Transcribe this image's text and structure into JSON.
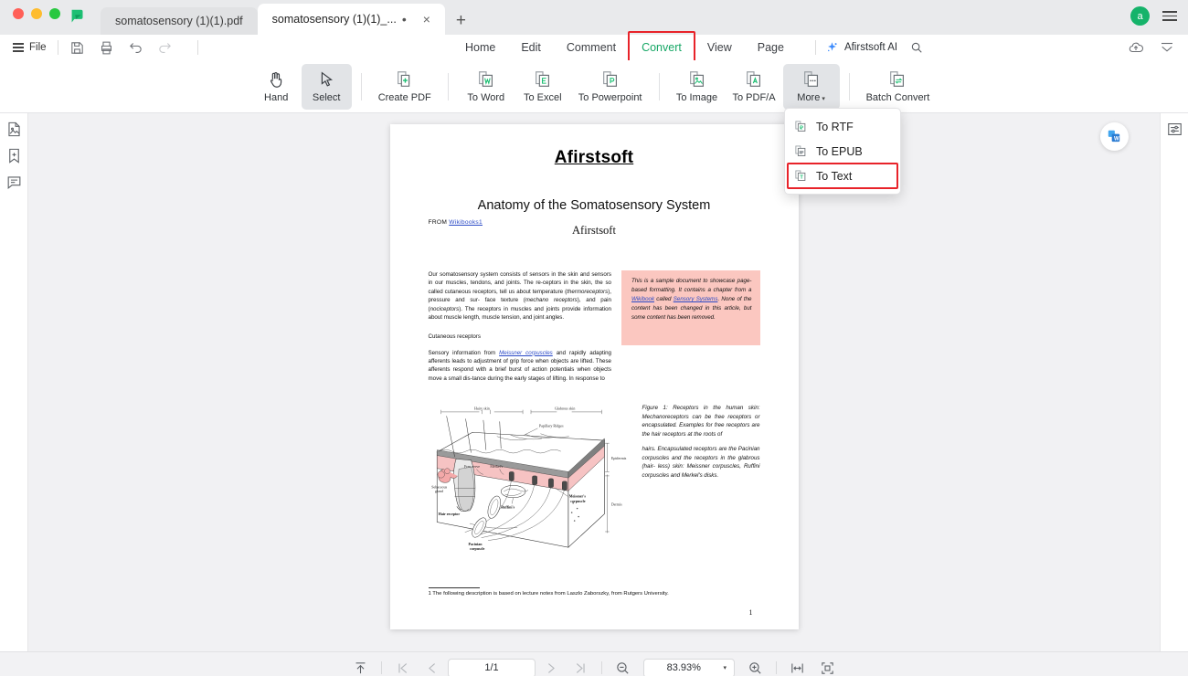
{
  "window": {
    "app_logo": "afirstsoft-flag-logo",
    "tabs": [
      {
        "title": "somatosensory (1)(1).pdf",
        "active": false
      },
      {
        "title": "somatosensory (1)(1)_...",
        "active": true,
        "modified_dot": "•",
        "close": "×"
      }
    ],
    "new_tab_label": "+",
    "avatar_initial": "a",
    "menu_icon": "hamburger-menu-icon"
  },
  "menubar": {
    "file_label": "File",
    "quick_icons": [
      "save-icon",
      "print-icon",
      "undo-icon",
      "redo-icon"
    ],
    "tabs": [
      {
        "label": "Home",
        "active": false
      },
      {
        "label": "Edit",
        "active": false
      },
      {
        "label": "Comment",
        "active": false
      },
      {
        "label": "Convert",
        "active": true,
        "highlighted": true
      },
      {
        "label": "View",
        "active": false
      },
      {
        "label": "Page",
        "active": false
      }
    ],
    "ai_label": "Afirstsoft AI",
    "ai_icon": "sparkle-icon",
    "search_icon": "search-icon",
    "right_icons": [
      "cloud-upload-icon",
      "collapse-ribbon-icon"
    ],
    "highlight_color": "#e8232a",
    "active_color": "#16a765"
  },
  "ribbon": {
    "items": [
      {
        "label": "Hand",
        "icon": "hand-icon",
        "active": false
      },
      {
        "label": "Select",
        "icon": "cursor-select-icon",
        "active": true
      },
      {
        "label": "Create PDF",
        "icon": "create-pdf-icon",
        "active": false
      },
      {
        "label": "To Word",
        "icon": "to-word-icon",
        "active": false
      },
      {
        "label": "To Excel",
        "icon": "to-excel-icon",
        "active": false
      },
      {
        "label": "To Powerpoint",
        "icon": "to-powerpoint-icon",
        "active": false
      },
      {
        "label": "To Image",
        "icon": "to-image-icon",
        "active": false
      },
      {
        "label": "To PDF/A",
        "icon": "to-pdfa-icon",
        "active": false
      },
      {
        "label": "More",
        "icon": "more-icon",
        "active": true,
        "caret": "▾"
      },
      {
        "label": "Batch Convert",
        "icon": "batch-convert-icon",
        "active": false
      }
    ]
  },
  "dropdown": {
    "open": true,
    "items": [
      {
        "label": "To RTF",
        "icon": "to-rtf-icon",
        "highlighted": false
      },
      {
        "label": "To EPUB",
        "icon": "to-epub-icon",
        "highlighted": false
      },
      {
        "label": "To Text",
        "icon": "to-text-icon",
        "highlighted": true
      }
    ]
  },
  "left_rail": {
    "items": [
      "thumbnails-icon",
      "bookmark-add-icon",
      "comment-icon"
    ]
  },
  "right_rail": {
    "items": [
      "properties-panel-icon"
    ]
  },
  "canvas": {
    "floating_badge": "convert-to-word-badge"
  },
  "document": {
    "brand_heading": "Afirstsoft",
    "title": "Anatomy of the Somatosensory System",
    "subtitle": "Afirstsoft",
    "from_label": "FROM",
    "from_link": "Wikibooks",
    "from_footnote_marker": "1",
    "paragraph_1": "Our somatosensory system consists of sensors in the skin and sensors in our muscles, tendons, and joints. The receptors in the skin, the so called cutaneous receptors, tell us about temperature (thermoreceptors), pressure and sur- face texture (mechano receptors), and pain (nociceptors). The receptors in muscles and joints provide information about muscle length, muscle tension, and joint angles.",
    "subheading": "Cutaneous receptors",
    "paragraph_2": "Sensory information from Meissner corpuscles and rapidly adapting afferents leads to adjustment of grip force when objects are lifted. These afferents respond with a brief burst of action potentials when objects move a small dis-tance during the early stages of lifting. In response to",
    "paragraph_2_link": "Meissner corpuscles",
    "sample_note": {
      "text_before": "This is a sample document to showcase page-based formatting. It contains a chapter from a ",
      "link_1": "Wikibook",
      "text_mid": " called ",
      "link_2": "Sensory Systems",
      "text_after": ". None of the content has been changed in this article, but some content has been removed.",
      "background": "#fbc7c0"
    },
    "figure_caption_1": "Figure 1: Receptors in the human skin: Mechanoreceptors can be free receptors or encapsulated. Examples for free receptors are the hair receptors at the roots of",
    "figure_caption_2": "hairs. Encapsulated receptors are the Pacinian corpuscles and the receptors in the glabrous (hair- less) skin: Meissner corpuscles, Ruffini corpuscles and Merkel's disks.",
    "figure_labels": {
      "hairy_skin": "Hairy skin",
      "glabrous_skin": "Glabrous skin",
      "papillary_ridges": "Papillary Ridges",
      "epidermis": "Epidermis",
      "dermis": "Dermis",
      "sebaceous_gland": "Sebaceous gland",
      "hair_receptor": "Hair receptor",
      "pacinian_corpuscle": "Pacinian corpuscle",
      "meissners_corpuscle": "Meissner's corpuscle",
      "ruffinis": "Ruffini's"
    },
    "footnote": "1 The following description is based on lecture notes from Laszlo Zaborszky, from Rutgers University.",
    "page_number": "1"
  },
  "bottombar": {
    "fit_top_icon": "scroll-to-top-icon",
    "first_page_icon": "first-page-icon",
    "prev_page_icon": "prev-page-icon",
    "page_value": "1/1",
    "next_page_icon": "next-page-icon",
    "last_page_icon": "last-page-icon",
    "zoom_out_icon": "zoom-out-icon",
    "zoom_value": "83.93%",
    "zoom_caret": "▾",
    "zoom_in_icon": "zoom-in-icon",
    "fit_width_icon": "fit-width-icon",
    "fit_page_icon": "fit-page-icon"
  }
}
